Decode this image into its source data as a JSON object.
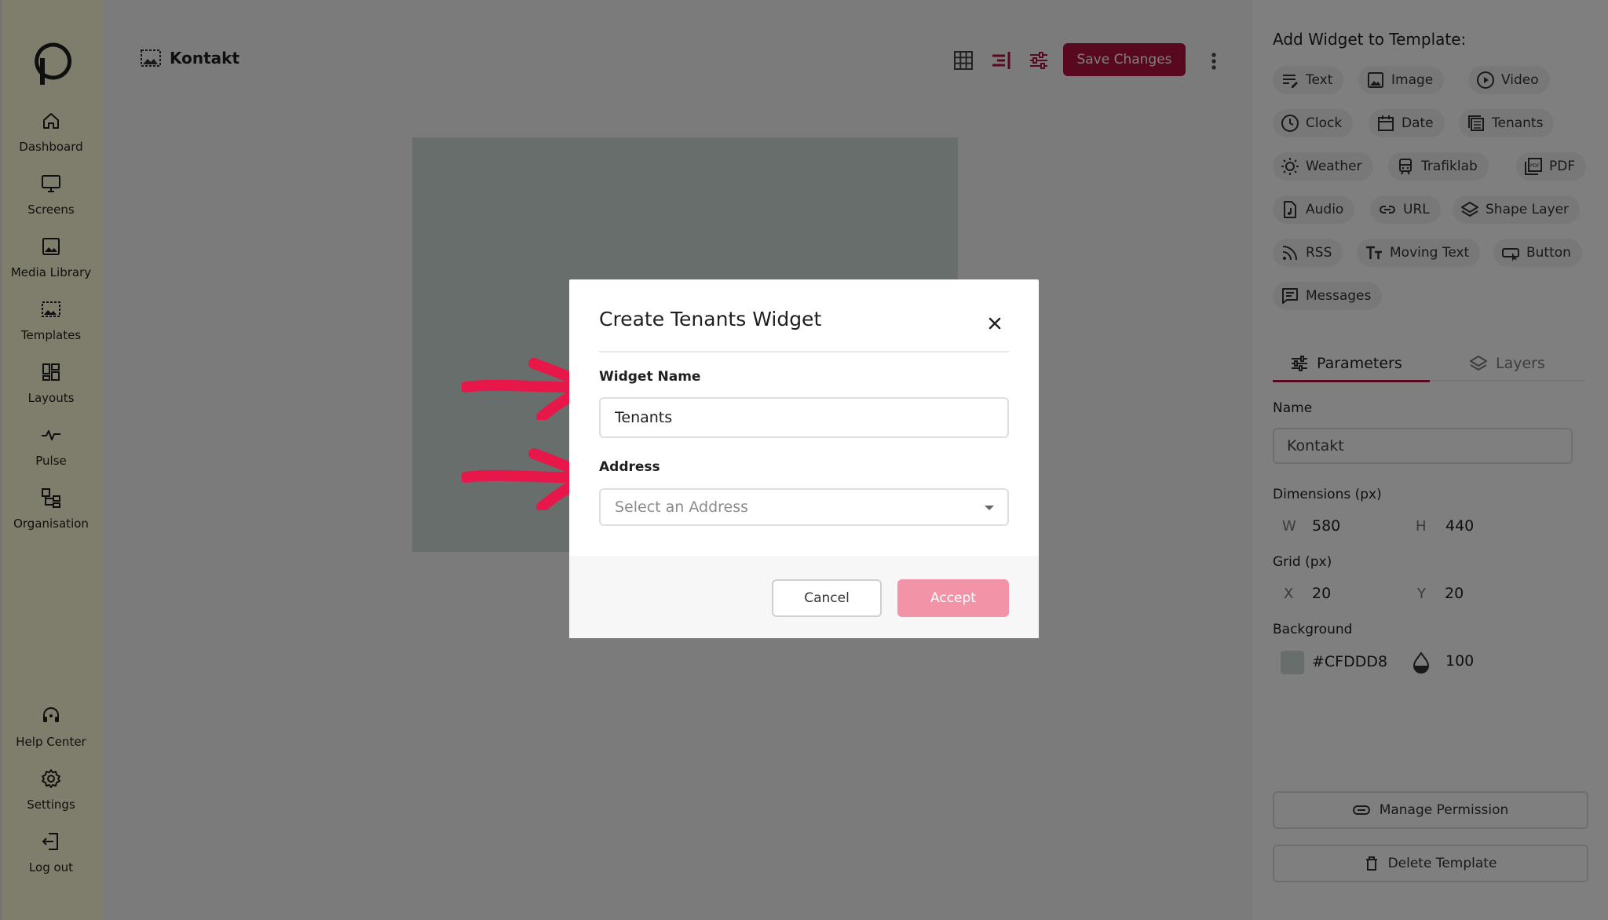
{
  "sidebar": {
    "items": [
      {
        "label": "Dashboard",
        "icon": "home-icon"
      },
      {
        "label": "Screens",
        "icon": "monitor-icon"
      },
      {
        "label": "Media Library",
        "icon": "image-icon"
      },
      {
        "label": "Templates",
        "icon": "template-icon"
      },
      {
        "label": "Layouts",
        "icon": "layout-grid-icon"
      },
      {
        "label": "Pulse",
        "icon": "pulse-icon"
      },
      {
        "label": "Organisation",
        "icon": "org-icon"
      }
    ],
    "bottom_items": [
      {
        "label": "Help Center",
        "icon": "help-headset-icon"
      },
      {
        "label": "Settings",
        "icon": "gear-icon"
      },
      {
        "label": "Log out",
        "icon": "logout-icon"
      }
    ]
  },
  "header": {
    "template_name": "Kontakt",
    "save_label": "Save Changes"
  },
  "canvas": {
    "background_color": "#CFDDD8"
  },
  "right_panel": {
    "heading": "Add Widget to Template:",
    "widgets": [
      {
        "label": "Text",
        "icon": "text-icon"
      },
      {
        "label": "Image",
        "icon": "image-icon"
      },
      {
        "label": "Video",
        "icon": "play-circle-icon"
      },
      {
        "label": "Clock",
        "icon": "clock-icon"
      },
      {
        "label": "Date",
        "icon": "calendar-icon"
      },
      {
        "label": "Tenants",
        "icon": "building-icon"
      },
      {
        "label": "Weather",
        "icon": "sun-icon"
      },
      {
        "label": "Trafiklab",
        "icon": "train-icon"
      },
      {
        "label": "PDF",
        "icon": "pdf-icon"
      },
      {
        "label": "Audio",
        "icon": "audio-file-icon"
      },
      {
        "label": "URL",
        "icon": "link-icon"
      },
      {
        "label": "Shape Layer",
        "icon": "layers-icon"
      },
      {
        "label": "RSS",
        "icon": "rss-icon"
      },
      {
        "label": "Moving Text",
        "icon": "moving-text-icon"
      },
      {
        "label": "Button",
        "icon": "button-icon"
      },
      {
        "label": "Messages",
        "icon": "message-icon"
      }
    ],
    "tabs": [
      {
        "label": "Parameters",
        "active": true
      },
      {
        "label": "Layers",
        "active": false
      }
    ],
    "name_label": "Name",
    "name_value": "Kontakt",
    "dimensions_label": "Dimensions (px)",
    "w_label": "W",
    "w_value": "580",
    "h_label": "H",
    "h_value": "440",
    "grid_label": "Grid (px)",
    "x_label": "X",
    "x_value": "20",
    "y_label": "Y",
    "y_value": "20",
    "background_label": "Background",
    "background_value": "#CFDDD8",
    "opacity_value": "100",
    "manage_permission_label": "Manage Permission",
    "delete_template_label": "Delete Template"
  },
  "modal": {
    "title": "Create Tenants Widget",
    "widget_name_label": "Widget Name",
    "widget_name_value": "Tenants",
    "address_label": "Address",
    "address_placeholder": "Select an Address",
    "cancel_label": "Cancel",
    "accept_label": "Accept"
  },
  "colors": {
    "accent": "#B3133F",
    "accent_disabled": "#F293A7",
    "sidebar_bg": "#FFFBD6",
    "annotation_arrow": "#E8174A"
  }
}
